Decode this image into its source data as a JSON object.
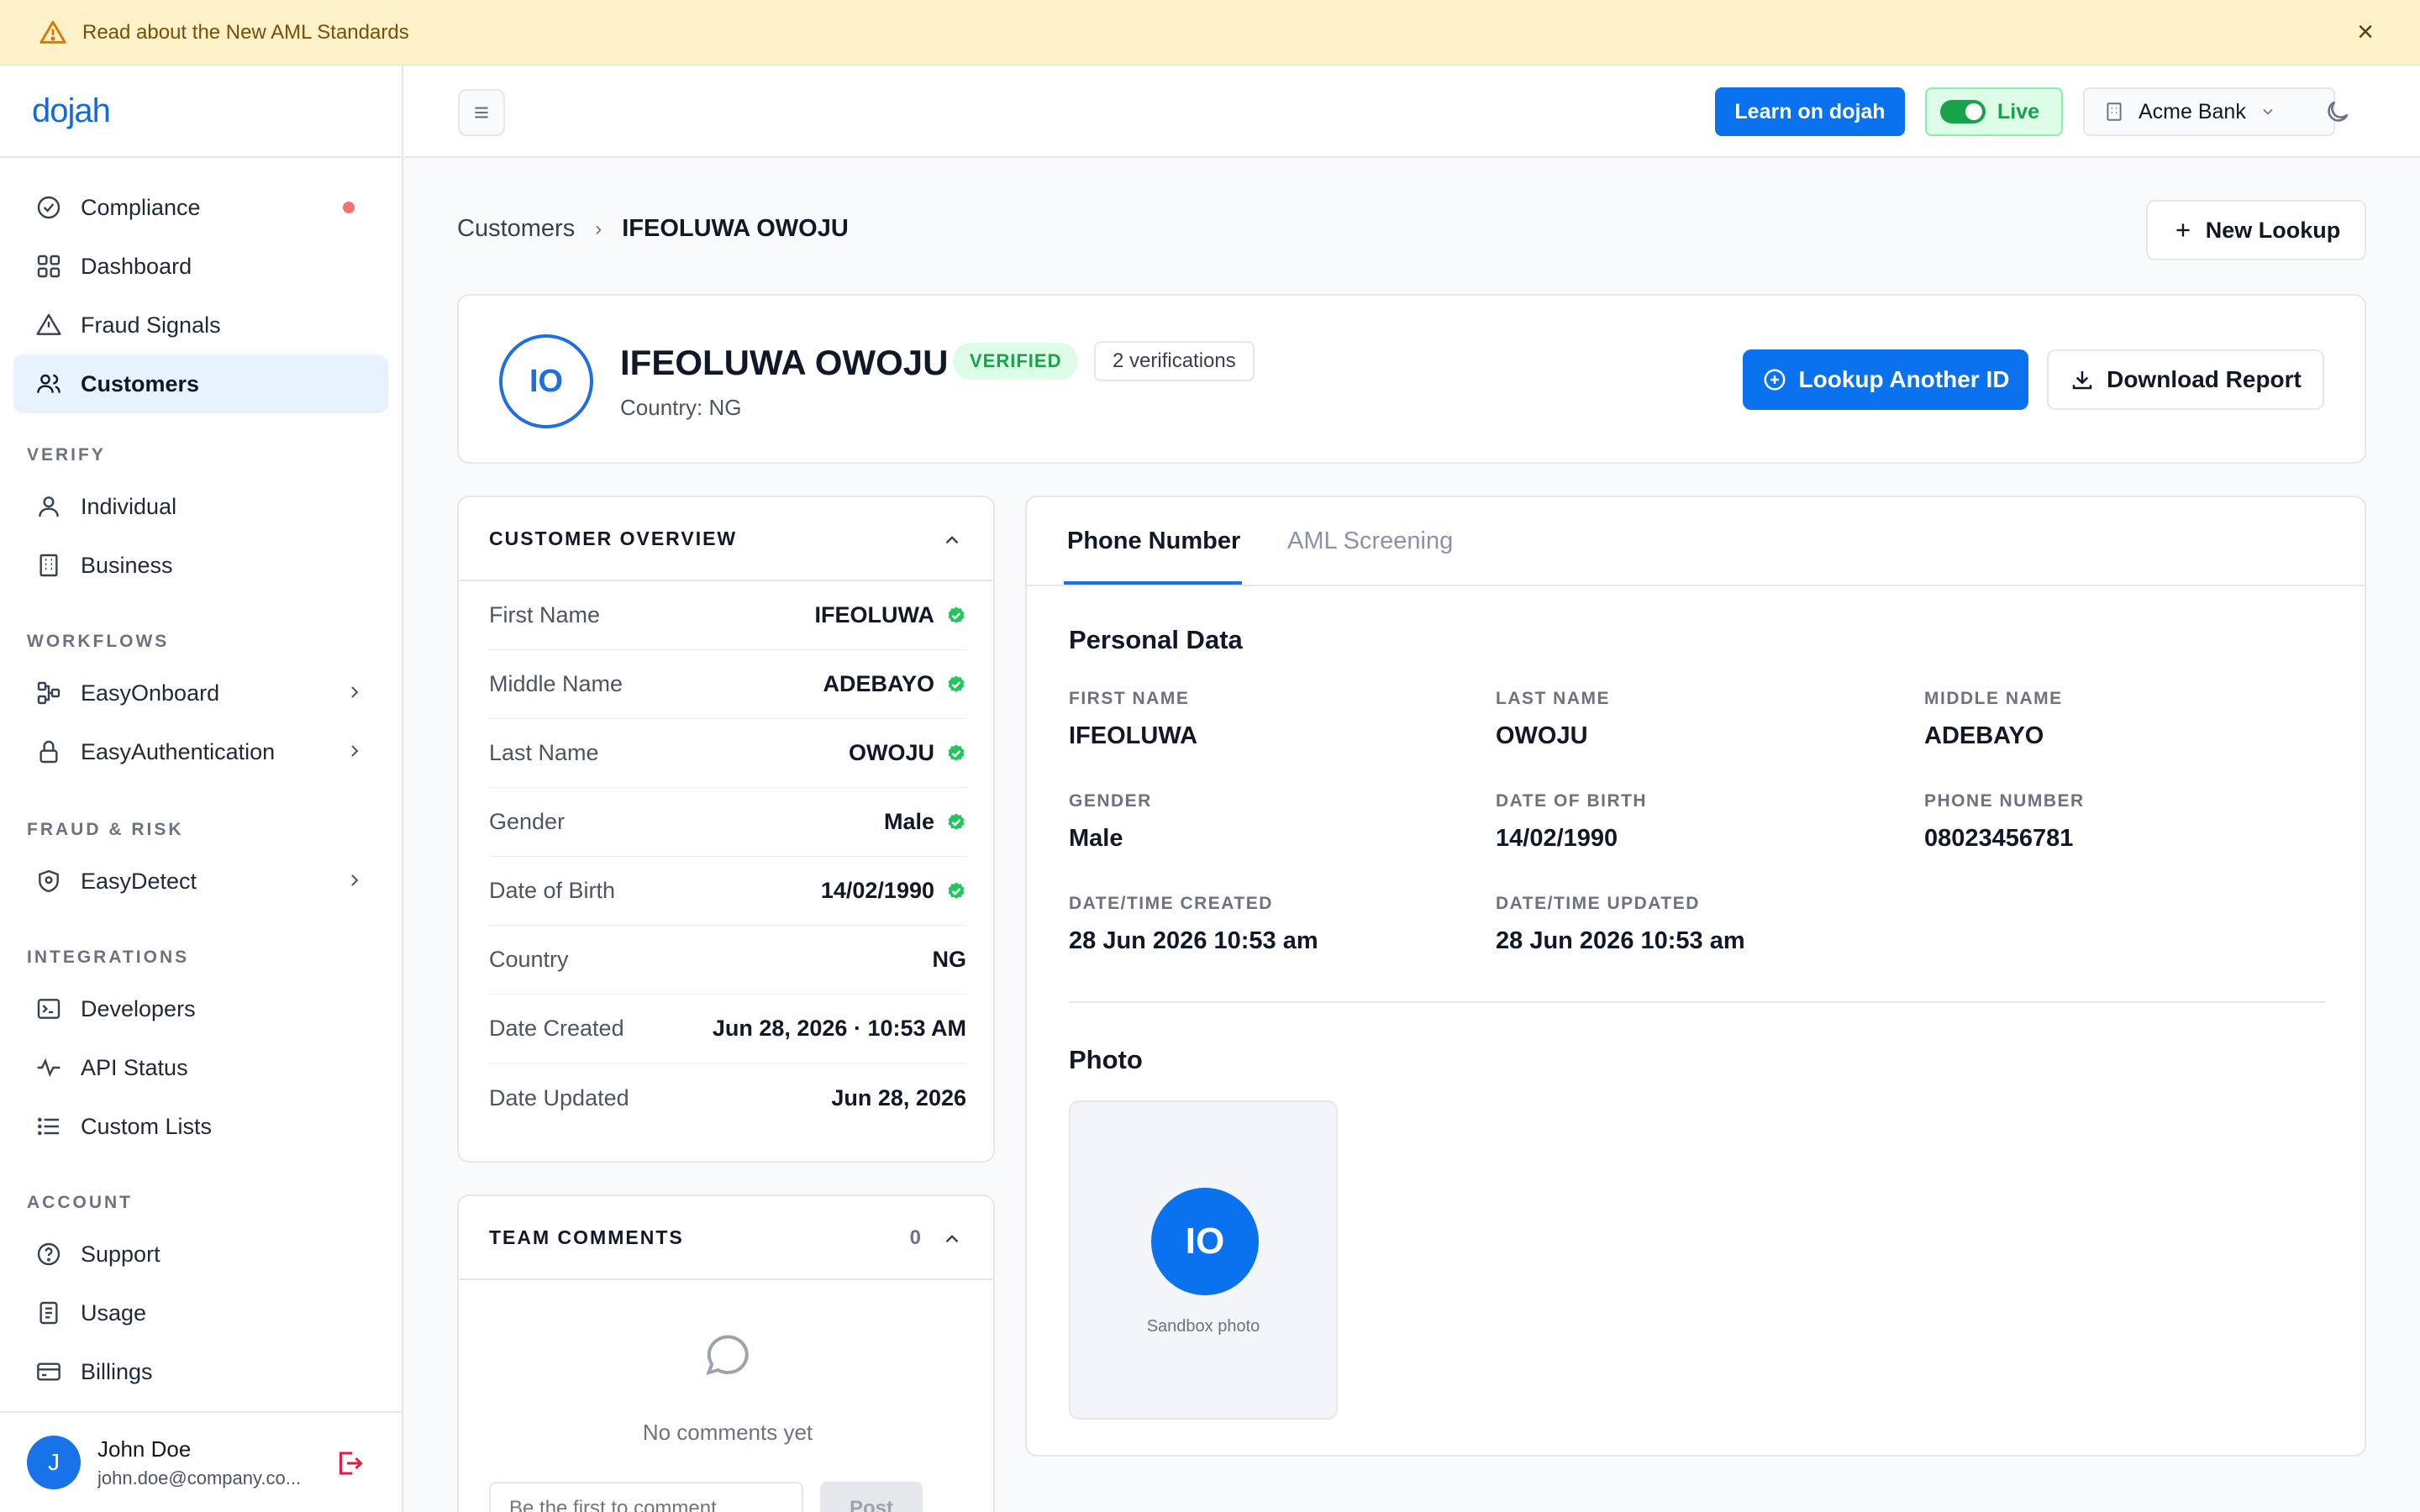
{
  "banner": {
    "text": "Read about the New AML Standards"
  },
  "brand": {
    "logo_text": "dojah",
    "accent": "#0a72ef"
  },
  "sidebar": {
    "top_items": [
      {
        "label": "Compliance",
        "icon": "check-circle-icon"
      },
      {
        "label": "Dashboard",
        "icon": "grid-icon"
      },
      {
        "label": "Fraud Signals",
        "icon": "warning-icon"
      },
      {
        "label": "Customers",
        "icon": "users-icon"
      }
    ],
    "sections": {
      "verify": "VERIFY",
      "workflows": "WORKFLOWS",
      "fraud": "FRAUD & RISK",
      "integrations": "INTEGRATIONS",
      "account": "ACCOUNT"
    },
    "verify_items": [
      {
        "label": "Individual"
      },
      {
        "label": "Business"
      }
    ],
    "workflow_items": [
      {
        "label": "EasyOnboard"
      },
      {
        "label": "EasyAuthentication"
      }
    ],
    "fraud_items": [
      {
        "label": "EasyDetect"
      }
    ],
    "integration_items": [
      {
        "label": "Developers"
      },
      {
        "label": "API Status"
      },
      {
        "label": "Custom Lists"
      }
    ],
    "account_items": [
      {
        "label": "Support"
      },
      {
        "label": "Usage"
      },
      {
        "label": "Billings"
      }
    ],
    "user": {
      "initial": "J",
      "name": "John Doe",
      "email": "john.doe@company.co..."
    }
  },
  "topbar": {
    "learn_label": "Learn on dojah",
    "live_label": "Live",
    "org_label": "Acme Bank"
  },
  "breadcrumb": {
    "parent": "Customers",
    "current": "IFEOLUWA OWOJU"
  },
  "new_lookup_label": "New Lookup",
  "profile": {
    "initials": "IO",
    "name": "IFEOLUWA OWOJU",
    "status": "VERIFIED",
    "verifications": "2 verifications",
    "country": "Country: NG",
    "lookup_label": "Lookup Another ID",
    "download_label": "Download Report"
  },
  "overview": {
    "title": "CUSTOMER OVERVIEW",
    "rows": [
      {
        "key": "First Name",
        "value": "IFEOLUWA"
      },
      {
        "key": "Middle Name",
        "value": "ADEBAYO"
      },
      {
        "key": "Last Name",
        "value": "OWOJU"
      },
      {
        "key": "Gender",
        "value": "Male"
      },
      {
        "key": "Date of Birth",
        "value": "14/02/1990"
      },
      {
        "key": "Country",
        "value": "NG"
      },
      {
        "key": "Date Created",
        "value": "Jun 28, 2026 · 10:53 AM"
      },
      {
        "key": "Date Updated",
        "value": "Jun 28, 2026"
      }
    ]
  },
  "comments": {
    "title": "TEAM COMMENTS",
    "count": "0",
    "empty_text": "No comments yet",
    "placeholder": "Be the first to comment...",
    "post_label": "Post"
  },
  "details": {
    "tabs": [
      {
        "label": "Phone Number"
      },
      {
        "label": "AML Screening"
      }
    ],
    "personal_title": "Personal Data",
    "fields": [
      {
        "label": "FIRST NAME",
        "value": "IFEOLUWA"
      },
      {
        "label": "LAST NAME",
        "value": "OWOJU"
      },
      {
        "label": "MIDDLE NAME",
        "value": "ADEBAYO"
      },
      {
        "label": "GENDER",
        "value": "Male"
      },
      {
        "label": "DATE OF BIRTH",
        "value": "14/02/1990"
      },
      {
        "label": "PHONE NUMBER",
        "value": "08023456781"
      },
      {
        "label": "DATE/TIME CREATED",
        "value": "28 Jun 2026 10:53 am"
      },
      {
        "label": "DATE/TIME UPDATED",
        "value": "28 Jun 2026 10:53 am"
      }
    ],
    "photo_title": "Photo",
    "photo_initials": "IO",
    "photo_caption": "Sandbox photo"
  }
}
